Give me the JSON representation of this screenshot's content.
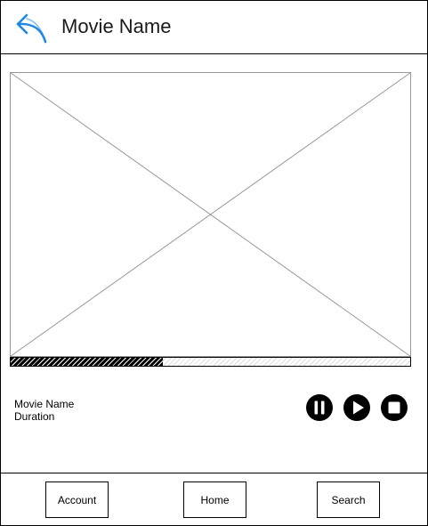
{
  "header": {
    "title": "Movie Name",
    "back_icon": "reply-arrow-icon",
    "accent_color": "#1e88e5"
  },
  "player": {
    "media_placeholder": "image-placeholder",
    "progress": 0.38,
    "movie_name": "Movie Name",
    "duration_label": "Duration",
    "controls": [
      "pause-icon",
      "play-icon",
      "stop-icon"
    ]
  },
  "footer": {
    "buttons": [
      "Account",
      "Home",
      "Search"
    ]
  }
}
